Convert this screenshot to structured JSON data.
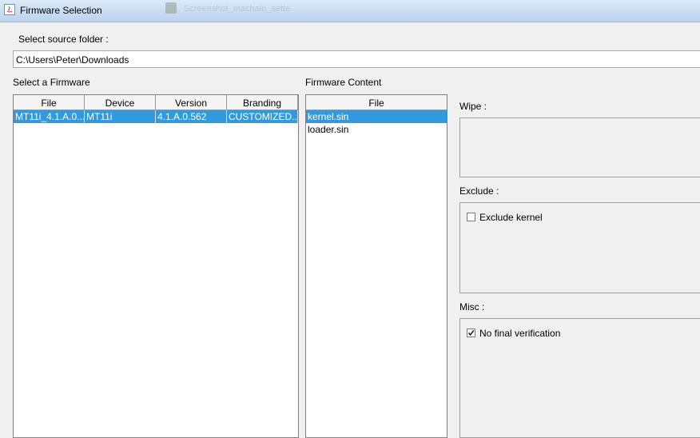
{
  "window": {
    "title": "Firmware Selection",
    "background_window_text": "Screenshot_machain_sette"
  },
  "source_folder": {
    "label": "Select source folder :",
    "path": "C:\\Users\\Peter\\Downloads"
  },
  "firmware_list": {
    "label": "Select a Firmware",
    "columns": [
      "File",
      "Device",
      "Version",
      "Branding"
    ],
    "rows": [
      {
        "file": "MT11i_4.1.A.0....",
        "device": "MT11i",
        "version": "4.1.A.0.562",
        "branding": "CUSTOMIZED...",
        "selected": true
      }
    ]
  },
  "firmware_content": {
    "label": "Firmware Content",
    "columns": [
      "File"
    ],
    "rows": [
      {
        "file": "kernel.sin",
        "selected": true
      },
      {
        "file": "loader.sin",
        "selected": false
      }
    ]
  },
  "wipe": {
    "label": "Wipe :"
  },
  "exclude": {
    "label": "Exclude :",
    "options": [
      {
        "label": "Exclude kernel",
        "checked": false
      }
    ]
  },
  "misc": {
    "label": "Misc :",
    "options": [
      {
        "label": "No final verification",
        "checked": true
      }
    ]
  },
  "colors": {
    "selection": "#3399dd",
    "titlebar": "#c7dcf2"
  }
}
